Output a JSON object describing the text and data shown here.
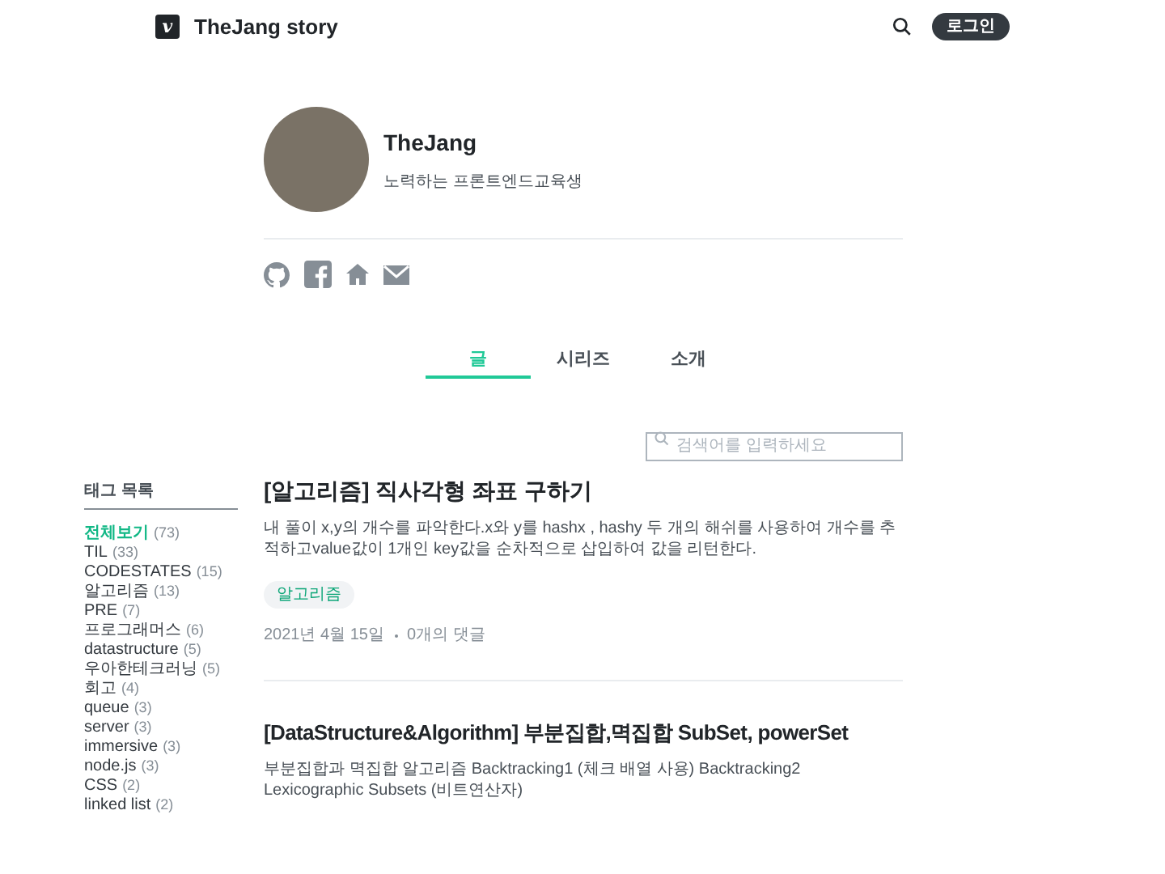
{
  "header": {
    "logo": "v",
    "title": "TheJang story",
    "login": "로그인"
  },
  "profile": {
    "name": "TheJang",
    "bio": "노력하는 프론트엔드교육생"
  },
  "tabs": [
    {
      "label": "글",
      "selected": true
    },
    {
      "label": "시리즈",
      "selected": false
    },
    {
      "label": "소개",
      "selected": false
    }
  ],
  "search": {
    "placeholder": "검색어를 입력하세요"
  },
  "tag_list": {
    "title": "태그 목록",
    "items": [
      {
        "name": "전체보기",
        "count": "(73)",
        "selected": true
      },
      {
        "name": "TIL",
        "count": "(33)",
        "selected": false
      },
      {
        "name": "CODESTATES",
        "count": "(15)",
        "selected": false
      },
      {
        "name": "알고리즘",
        "count": "(13)",
        "selected": false
      },
      {
        "name": "PRE",
        "count": "(7)",
        "selected": false
      },
      {
        "name": "프로그래머스",
        "count": "(6)",
        "selected": false
      },
      {
        "name": "datastructure",
        "count": "(5)",
        "selected": false
      },
      {
        "name": "우아한테크러닝",
        "count": "(5)",
        "selected": false
      },
      {
        "name": "회고",
        "count": "(4)",
        "selected": false
      },
      {
        "name": "queue",
        "count": "(3)",
        "selected": false
      },
      {
        "name": "server",
        "count": "(3)",
        "selected": false
      },
      {
        "name": "immersive",
        "count": "(3)",
        "selected": false
      },
      {
        "name": "node.js",
        "count": "(3)",
        "selected": false
      },
      {
        "name": "CSS",
        "count": "(2)",
        "selected": false
      },
      {
        "name": "linked list",
        "count": "(2)",
        "selected": false
      }
    ]
  },
  "posts": [
    {
      "title": "[알고리즘] 직사각형 좌표 구하기",
      "summary": "내 풀이 x,y의 개수를 파악한다.x와 y를 hashx , hashy 두 개의 해쉬를 사용하여 개수를 추적하고value값이 1개인 key값을 순차적으로 삽입하여 값을 리턴한다.",
      "tags": [
        "알고리즘"
      ],
      "date": "2021년 4월 15일",
      "comments": "0개의 댓글"
    },
    {
      "title": "[DataStructure&Algorithm] 부분집합,멱집합 SubSet, powerSet",
      "summary": "부분집합과 멱집합 알고리즘 Backtracking1 (체크 배열 사용) Backtracking2 Lexicographic Subsets (비트연산자)"
    }
  ]
}
